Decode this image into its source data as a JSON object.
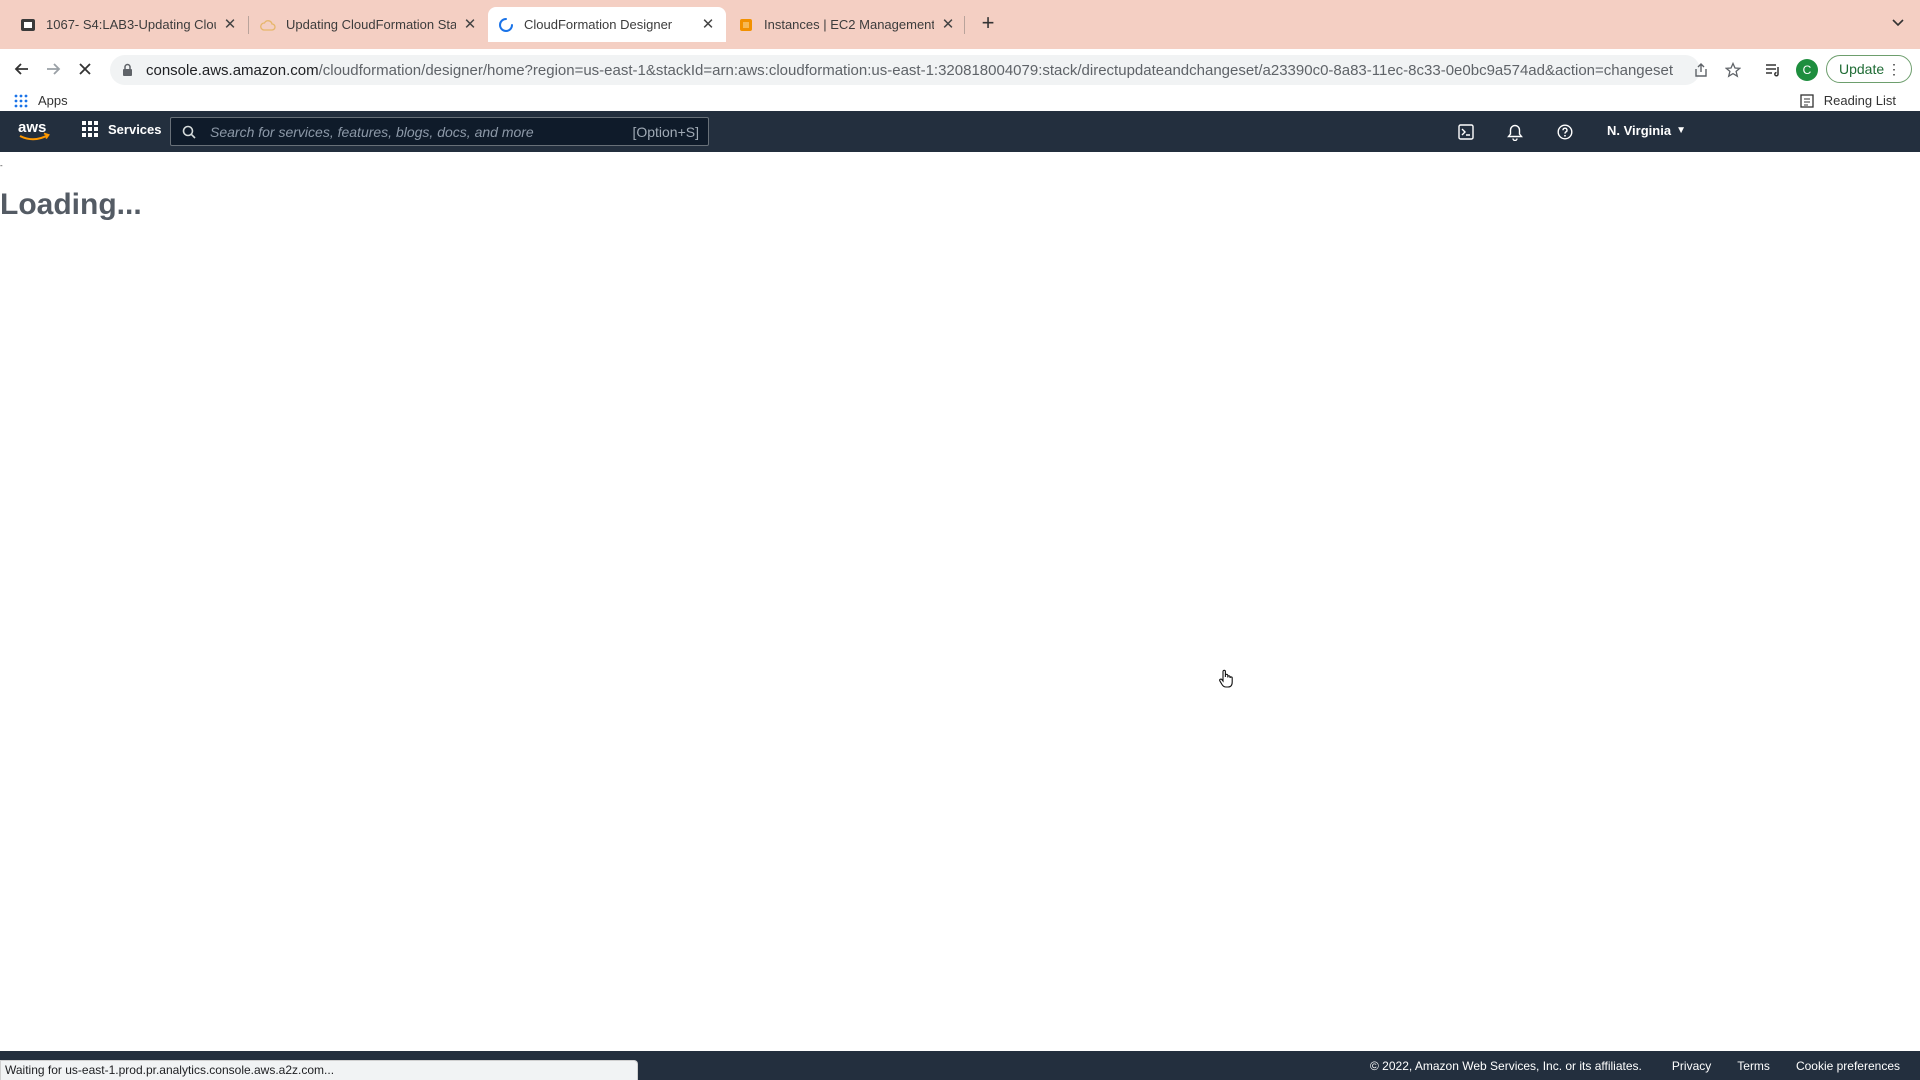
{
  "browser": {
    "tabs": [
      {
        "title": "1067- S4:LAB3-Updating Clou",
        "icon": "lab-icon"
      },
      {
        "title": "Updating CloudFormation Stac",
        "icon": "cloud-icon"
      },
      {
        "title": "CloudFormation Designer",
        "icon": "loading-spinner-icon",
        "active": true
      },
      {
        "title": "Instances | EC2 Management (",
        "icon": "ec2-icon"
      }
    ],
    "url_host": "console.aws.amazon.com",
    "url_path": "/cloudformation/designer/home?region=us-east-1&stackId=arn:aws:cloudformation:us-east-1:320818004079:stack/directupdateandchangeset/a23390c0-8a83-11ec-8c33-0e0bc9a574ad&action=changeset",
    "profile_initial": "C",
    "update_label": "Update",
    "bookmarks": {
      "apps": "Apps",
      "reading_list": "Reading List"
    }
  },
  "aws_header": {
    "logo_text": "aws",
    "services_label": "Services",
    "search_placeholder": "Search for services, features, blogs, docs, and more",
    "search_shortcut": "[Option+S]",
    "region_label": "N. Virginia"
  },
  "main": {
    "tick": "-",
    "loading_text": "Loading..."
  },
  "footer": {
    "copyright": "© 2022, Amazon Web Services, Inc. or its affiliates.",
    "links": [
      "Privacy",
      "Terms",
      "Cookie preferences"
    ]
  },
  "status_bar": {
    "text": "Waiting for us-east-1.prod.pr.analytics.console.aws.a2z.com..."
  },
  "colors": {
    "tabstrip": "#f4cfc3",
    "aws_header": "#232f3e",
    "aws_orange": "#ff9900",
    "update_green": "#1e8e3e"
  }
}
